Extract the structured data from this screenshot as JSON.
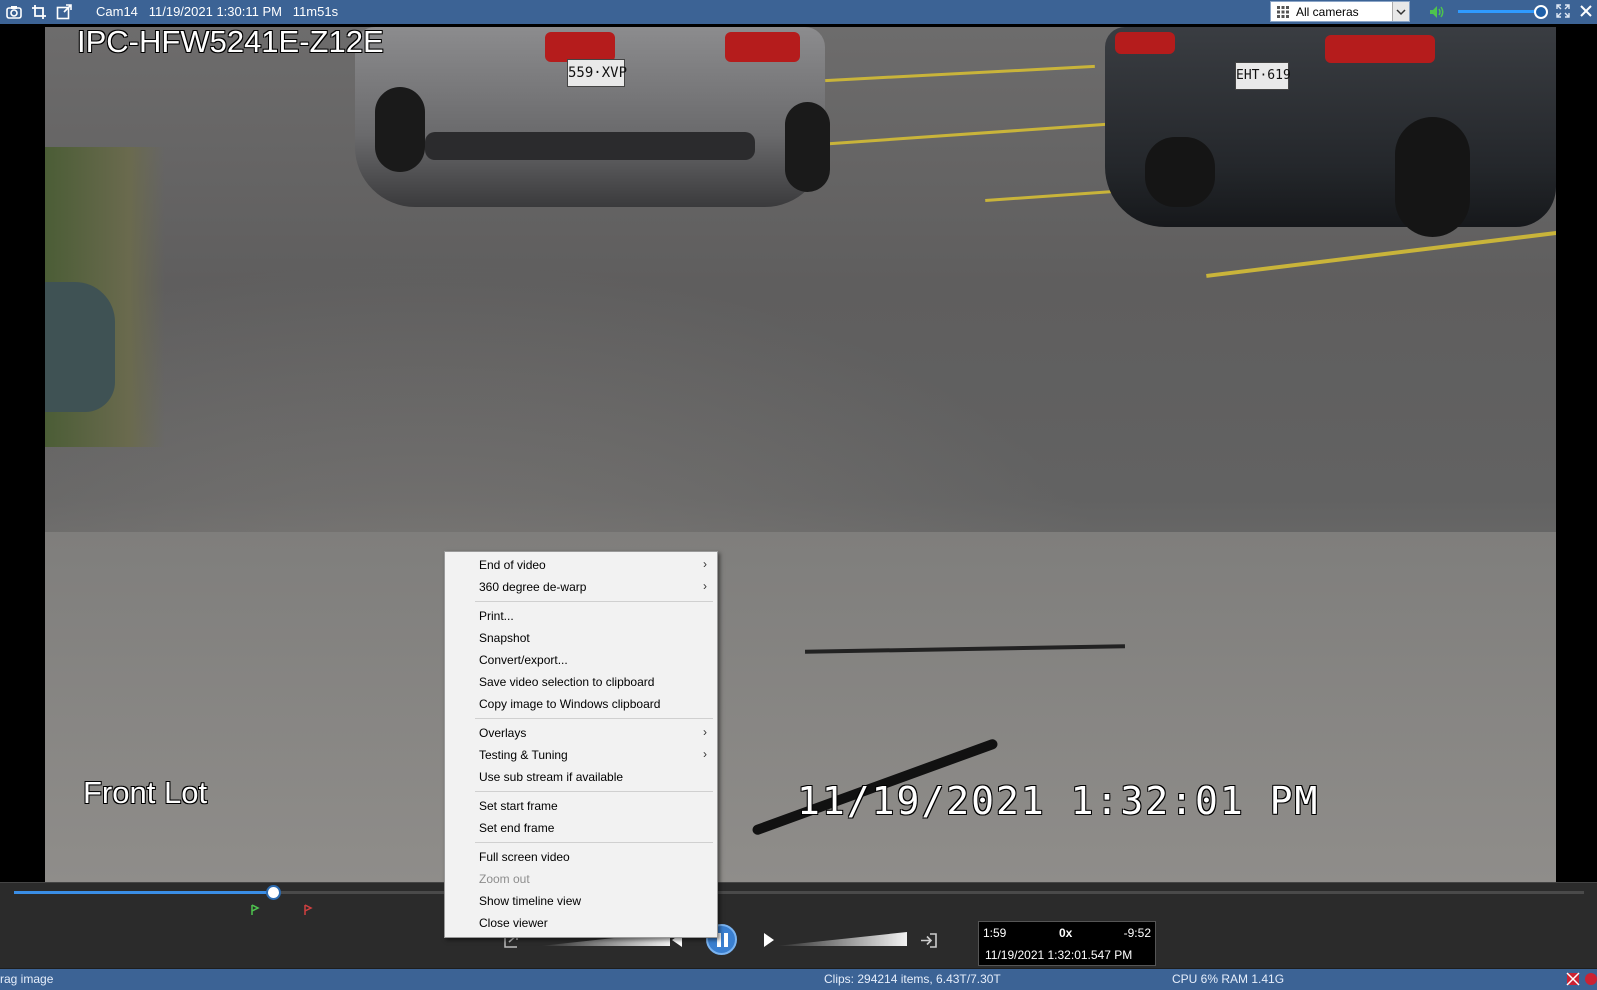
{
  "titlebar": {
    "title": "Cam14   11/19/2021 1:30:11 PM   11m51s",
    "camera_select": "All cameras",
    "volume_level": 0.95
  },
  "video": {
    "model_overlay": "IPC-HFW5241E-Z12E",
    "location_overlay": "Front Lot",
    "timestamp_overlay": "11/19/2021  1:32:01 PM",
    "plate1": "559·XVP",
    "plate2": "EHT·619"
  },
  "timeline": {
    "progress": 0.165,
    "elapsed": "1:59",
    "speed": "0x",
    "remaining": "-9:52",
    "datetime": "11/19/2021 1:32:01.547 PM"
  },
  "context_menu": {
    "items": [
      {
        "label": "End of video",
        "submenu": true
      },
      {
        "label": "360 degree de-warp",
        "submenu": true
      },
      {
        "label": "Print..."
      },
      {
        "label": "Snapshot"
      },
      {
        "label": "Convert/export..."
      },
      {
        "label": "Save video selection to clipboard"
      },
      {
        "label": "Copy image to Windows clipboard"
      },
      {
        "label": "Overlays",
        "submenu": true
      },
      {
        "label": "Testing & Tuning",
        "submenu": true
      },
      {
        "label": "Use sub stream if available"
      },
      {
        "label": "Set start frame"
      },
      {
        "label": "Set end frame"
      },
      {
        "label": "Full screen video"
      },
      {
        "label": "Zoom out",
        "disabled": true
      },
      {
        "label": "Show timeline view"
      },
      {
        "label": "Close viewer"
      }
    ],
    "arrow_glyph": "›"
  },
  "statusbar": {
    "left": "rag image",
    "clips": "Clips: 294214 items, 6.43T/7.30T",
    "cpu": "CPU 6% RAM 1.41G"
  },
  "colors": {
    "titlebar": "#3c6395",
    "accent": "#3a8ee6"
  }
}
